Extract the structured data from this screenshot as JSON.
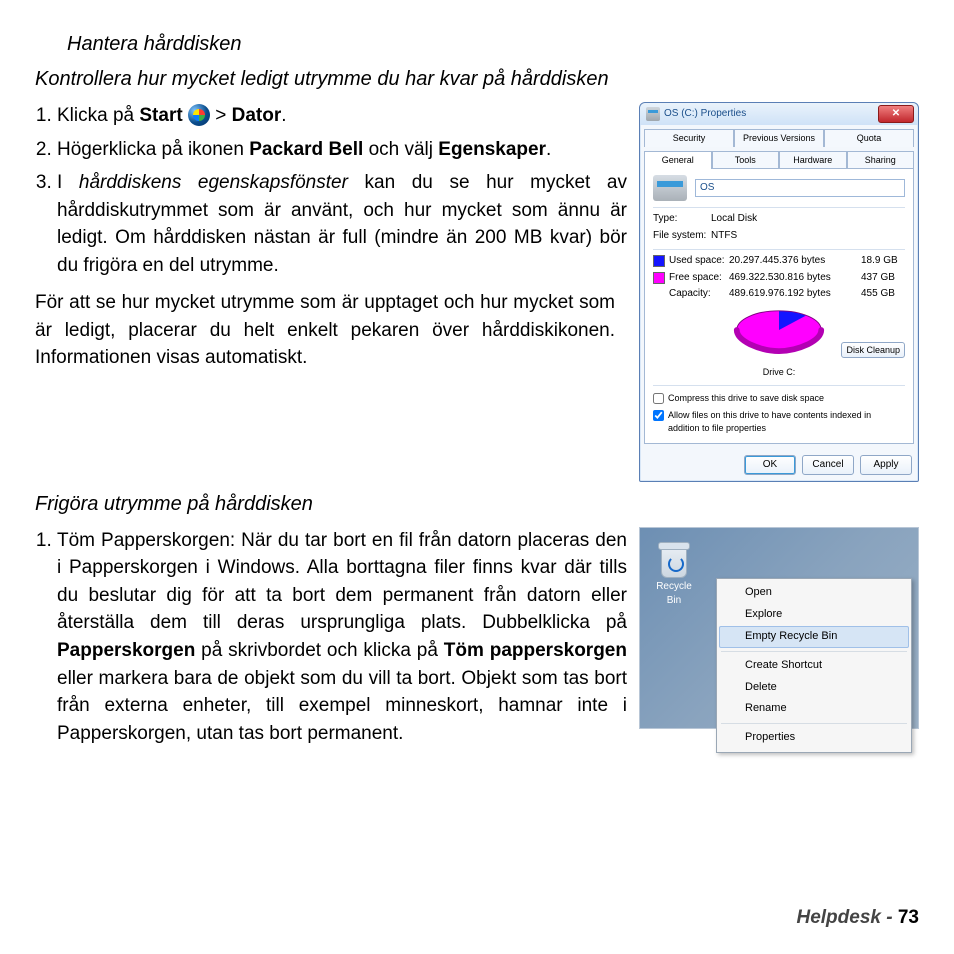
{
  "doc": {
    "heading1": "Hantera hårddisken",
    "heading2": "Kontrollera hur mycket ledigt utrymme du har kvar på hårddisken",
    "step1_a": "Klicka på ",
    "step1_start": "Start",
    "step1_gt": " > ",
    "step1_dator": "Dator",
    "step1_end": ".",
    "step2_a": "Högerklicka på ikonen ",
    "step2_pb": "Packard Bell",
    "step2_b": " och välj ",
    "step2_eg": "Egenskaper",
    "step2_end": ".",
    "step3_a": "I ",
    "step3_it": "hårddiskens egenskapsfönster",
    "step3_b": " kan du se hur mycket av hårddiskutrymmet som är använt, och hur mycket som ännu är ledigt. Om hårddisken nästan är full (mindre än 200 MB kvar) bör du frigöra en del utrymme.",
    "para_mid": "För att se hur mycket utrymme som är upptaget och hur mycket som är ledigt, placerar du helt enkelt pekaren över hårddiskikonen. Informationen visas automatiskt.",
    "heading3": "Frigöra utrymme på hårddisken",
    "fstep1_a": "Töm Papperskorgen: När du tar bort en fil från datorn placeras den i Papperskorgen i Windows. Alla borttagna filer finns kvar där tills du beslutar dig för att ta bort dem permanent från datorn eller återställa dem till deras ursprungliga plats. Dubbelklicka på ",
    "fstep1_b1": "Papperskorgen",
    "fstep1_c": " på skrivbordet och klicka på ",
    "fstep1_b2": "Töm papperskorgen",
    "fstep1_d": " eller markera bara de objekt som du vill ta bort. Objekt som tas bort från externa enheter, till exempel minneskort, hamnar inte i Papperskorgen, utan tas bort permanent."
  },
  "props": {
    "title": "OS (C:) Properties",
    "tabs_row1": [
      "Security",
      "Previous Versions",
      "Quota"
    ],
    "tabs_row2": [
      "General",
      "Tools",
      "Hardware",
      "Sharing"
    ],
    "drive_name": "OS",
    "type_label": "Type:",
    "type_value": "Local Disk",
    "fs_label": "File system:",
    "fs_value": "NTFS",
    "used_label": "Used space:",
    "used_bytes": "20.297.445.376 bytes",
    "used_gb": "18.9 GB",
    "free_label": "Free space:",
    "free_bytes": "469.322.530.816 bytes",
    "free_gb": "437 GB",
    "cap_label": "Capacity:",
    "cap_bytes": "489.619.976.192 bytes",
    "cap_gb": "455 GB",
    "drive_c": "Drive C:",
    "cleanup": "Disk Cleanup",
    "chk1": "Compress this drive to save disk space",
    "chk2": "Allow files on this drive to have contents indexed in addition to file properties",
    "ok": "OK",
    "cancel": "Cancel",
    "apply": "Apply"
  },
  "ctx": {
    "rb_label": "Recycle Bin",
    "items": [
      "Open",
      "Explore",
      "Empty Recycle Bin",
      "Create Shortcut",
      "Delete",
      "Rename",
      "Properties"
    ]
  },
  "footer": {
    "label": "Helpdesk -  ",
    "page": "73"
  }
}
